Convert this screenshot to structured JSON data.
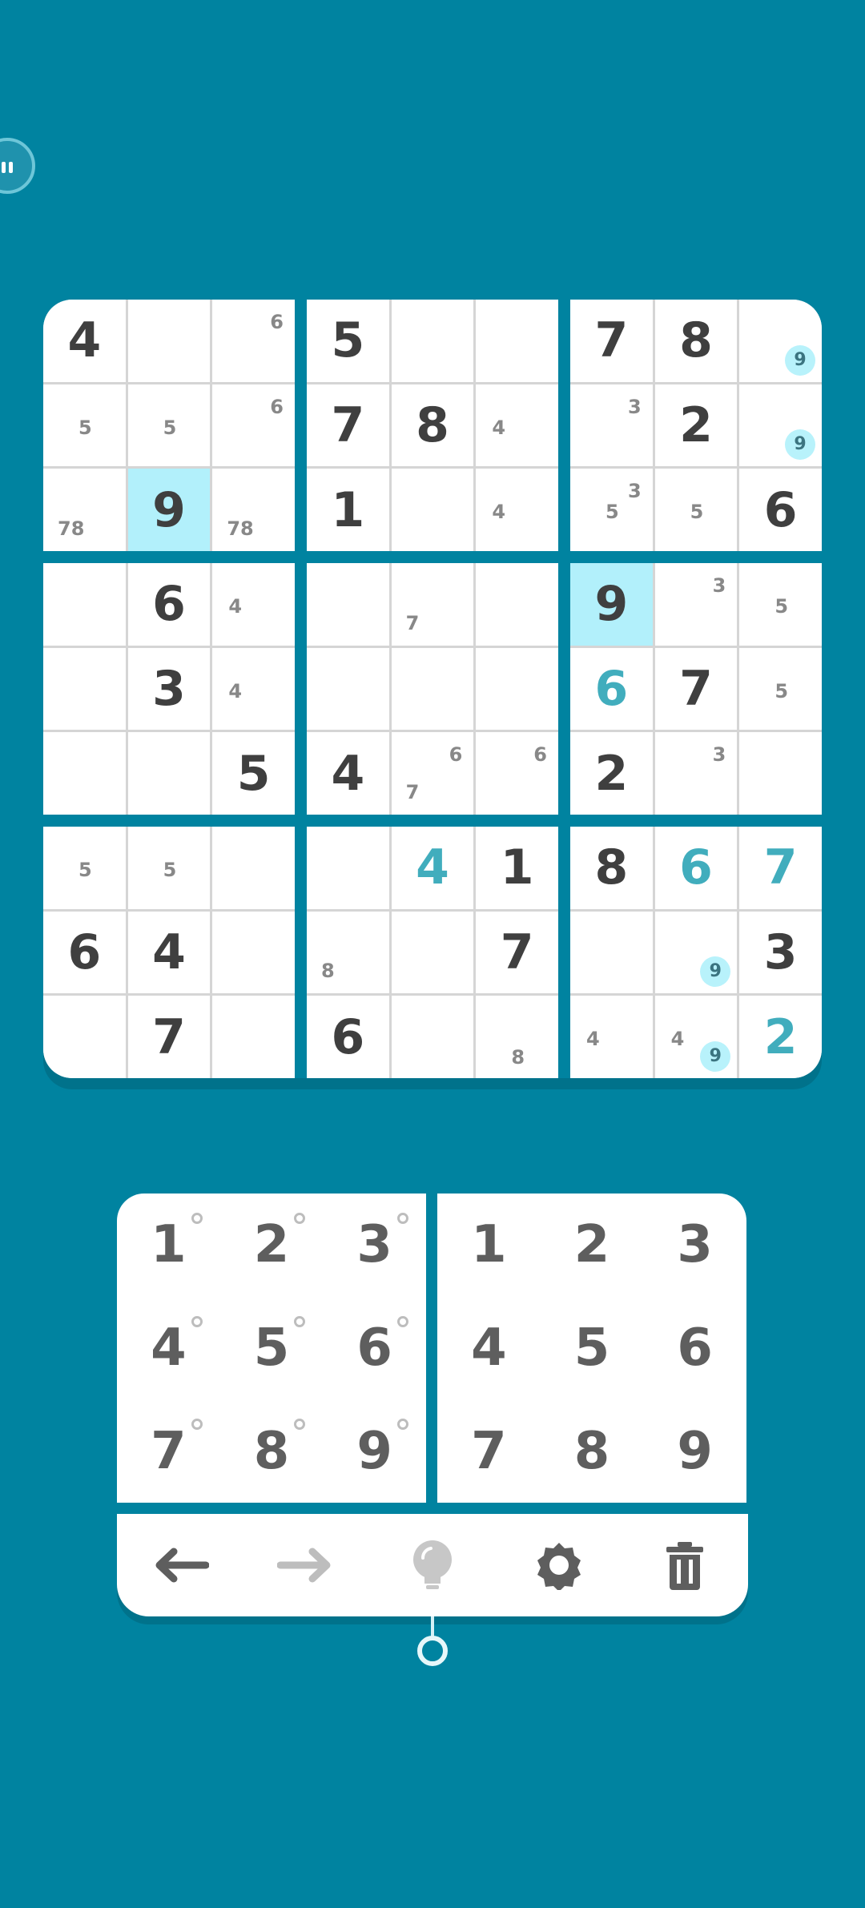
{
  "board": {
    "boxes": [
      [
        {
          "v": "4"
        },
        {},
        {
          "notes": [
            {
              "t": "6",
              "p": "tr"
            }
          ]
        },
        {
          "notes": [
            {
              "t": "5",
              "p": "mc"
            }
          ]
        },
        {
          "notes": [
            {
              "t": "5",
              "p": "mc"
            }
          ]
        },
        {
          "notes": [
            {
              "t": "6",
              "p": "tr"
            }
          ]
        },
        {
          "notes": [
            {
              "t": "78",
              "p": "bl"
            }
          ]
        },
        {
          "v": "9",
          "sel": true
        },
        {
          "notes": [
            {
              "t": "78",
              "p": "bl"
            }
          ]
        }
      ],
      [
        {
          "v": "5"
        },
        {},
        {},
        {
          "v": "7"
        },
        {
          "v": "8"
        },
        {
          "notes": [
            {
              "t": "4",
              "p": "ml"
            }
          ]
        },
        {
          "v": "1"
        },
        {},
        {
          "notes": [
            {
              "t": "4",
              "p": "ml"
            }
          ]
        }
      ],
      [
        {
          "v": "7"
        },
        {
          "v": "8"
        },
        {
          "notes": [
            {
              "t": "9",
              "p": "br",
              "hl": true
            }
          ]
        },
        {
          "notes": [
            {
              "t": "3",
              "p": "tr"
            }
          ]
        },
        {
          "v": "2"
        },
        {
          "notes": [
            {
              "t": "9",
              "p": "br",
              "hl": true
            }
          ]
        },
        {
          "notes": [
            {
              "t": "5",
              "p": "mc"
            },
            {
              "t": "3",
              "p": "tr"
            }
          ]
        },
        {
          "notes": [
            {
              "t": "5",
              "p": "mc"
            }
          ]
        },
        {
          "v": "6"
        }
      ],
      [
        {},
        {
          "v": "6"
        },
        {
          "notes": [
            {
              "t": "4",
              "p": "ml"
            }
          ]
        },
        {},
        {
          "v": "3"
        },
        {
          "notes": [
            {
              "t": "4",
              "p": "ml"
            }
          ]
        },
        {},
        {},
        {
          "v": "5"
        }
      ],
      [
        {},
        {
          "notes": [
            {
              "t": "7",
              "p": "bl"
            }
          ]
        },
        {},
        {},
        {},
        {},
        {
          "v": "4"
        },
        {
          "notes": [
            {
              "t": "7",
              "p": "bl"
            },
            {
              "t": "6",
              "p": "tr"
            }
          ]
        },
        {
          "notes": [
            {
              "t": "6",
              "p": "tr"
            }
          ]
        }
      ],
      [
        {
          "v": "9",
          "sel": true
        },
        {
          "notes": [
            {
              "t": "3",
              "p": "tr"
            }
          ]
        },
        {
          "notes": [
            {
              "t": "5",
              "p": "mc"
            }
          ]
        },
        {
          "v": "6",
          "user": true
        },
        {
          "v": "7"
        },
        {
          "notes": [
            {
              "t": "5",
              "p": "mc"
            }
          ]
        },
        {
          "v": "2"
        },
        {
          "notes": [
            {
              "t": "3",
              "p": "tr"
            }
          ]
        },
        {}
      ],
      [
        {
          "notes": [
            {
              "t": "5",
              "p": "mc"
            }
          ]
        },
        {
          "notes": [
            {
              "t": "5",
              "p": "mc"
            }
          ]
        },
        {},
        {
          "v": "6"
        },
        {
          "v": "4"
        },
        {},
        {},
        {
          "v": "7"
        },
        {}
      ],
      [
        {},
        {
          "v": "4",
          "user": true
        },
        {
          "v": "1"
        },
        {
          "notes": [
            {
              "t": "8",
              "p": "bl"
            }
          ]
        },
        {},
        {
          "v": "7"
        },
        {
          "v": "6"
        },
        {},
        {
          "notes": [
            {
              "t": "8",
              "p": "bc"
            }
          ]
        }
      ],
      [
        {
          "v": "8"
        },
        {
          "v": "6",
          "user": true
        },
        {
          "v": "7",
          "user": true
        },
        {},
        {
          "notes": [
            {
              "t": "9",
              "p": "br",
              "hl": true
            }
          ]
        },
        {
          "v": "3"
        },
        {
          "notes": [
            {
              "t": "4",
              "p": "ml"
            }
          ]
        },
        {
          "notes": [
            {
              "t": "4",
              "p": "ml"
            },
            {
              "t": "9",
              "p": "br",
              "hl": true
            }
          ]
        },
        {
          "v": "2",
          "user": true
        }
      ]
    ]
  },
  "pencil_keys": [
    "1",
    "2",
    "3",
    "4",
    "5",
    "6",
    "7",
    "8",
    "9"
  ],
  "number_keys": [
    "1",
    "2",
    "3",
    "4",
    "5",
    "6",
    "7",
    "8",
    "9"
  ],
  "toolbar": {
    "icons": [
      "undo-icon",
      "redo-icon",
      "hint-icon",
      "settings-icon",
      "delete-icon"
    ]
  },
  "colors": {
    "background": "#0083a0",
    "user_digit": "#41adbd",
    "selected_cell": "#b2f0fb",
    "given_digit": "#3f3f3f"
  }
}
